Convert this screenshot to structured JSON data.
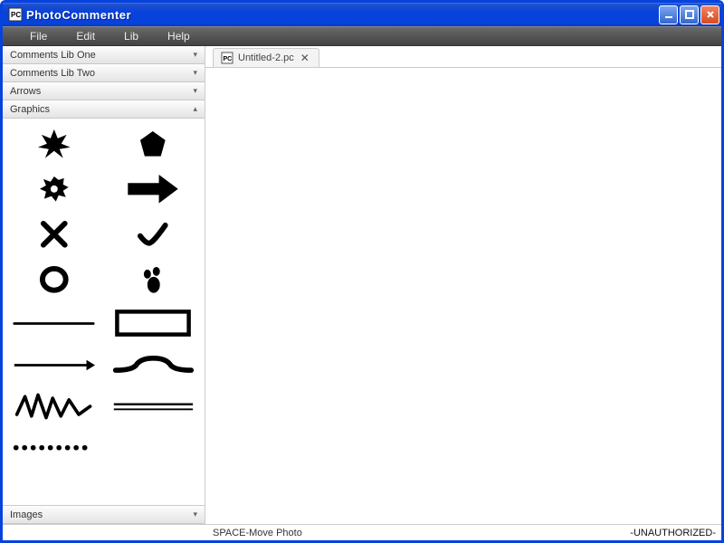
{
  "window": {
    "title": "PhotoCommenter"
  },
  "menu": {
    "items": [
      "File",
      "Edit",
      "Lib",
      "Help"
    ]
  },
  "sidebar": {
    "sections": [
      {
        "label": "Comments Lib One",
        "expanded": false
      },
      {
        "label": "Comments Lib Two",
        "expanded": false
      },
      {
        "label": "Arrows",
        "expanded": false
      },
      {
        "label": "Graphics",
        "expanded": true
      },
      {
        "label": "Images",
        "expanded": false
      }
    ],
    "graphics_shapes": [
      "burst-star",
      "pentagon",
      "gear-blob",
      "right-arrow",
      "cross-x",
      "checkmark",
      "circle-outline",
      "footprints",
      "thin-underline",
      "rectangle-outline",
      "thin-arrow",
      "curly-brace",
      "scribble-zigzag",
      "double-underline",
      "dotted-line"
    ]
  },
  "tabs": [
    {
      "label": "Untitled-2.pc",
      "active": true
    }
  ],
  "status": {
    "hint": "SPACE-Move Photo",
    "right": "-UNAUTHORIZED-"
  }
}
